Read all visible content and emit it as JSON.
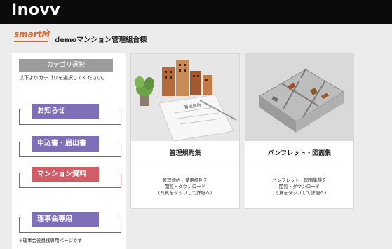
{
  "header": {
    "title": "Inovv"
  },
  "brand": {
    "logo_text": "smartM",
    "logo_sup": "2",
    "org_name": "demoマンション管理組合様"
  },
  "sidebar": {
    "header": "カテゴリ選択",
    "description": "以下よりカテゴリを選択してください。",
    "items": [
      {
        "label": "お知らせ"
      },
      {
        "label": "申込書・届出書"
      },
      {
        "label": "マンション資料"
      },
      {
        "label": "理事会専用"
      }
    ],
    "note": "※理事会役員様専用ページです"
  },
  "cards": [
    {
      "title": "管理規約集",
      "desc_lines": [
        "管理規約・使用細則を",
        "閲覧・ダウンロード",
        "(写真をタップして詳細へ)"
      ],
      "image_label": "管理規約"
    },
    {
      "title": "パンフレット・図面集",
      "desc_lines": [
        "パンフレット・図面集等を",
        "閲覧・ダウンロード",
        "(写真をタップして詳細へ)"
      ]
    }
  ],
  "colors": {
    "accent_purple": "#7d6fb8",
    "accent_red": "#d05d67",
    "logo_orange": "#e0632e"
  }
}
